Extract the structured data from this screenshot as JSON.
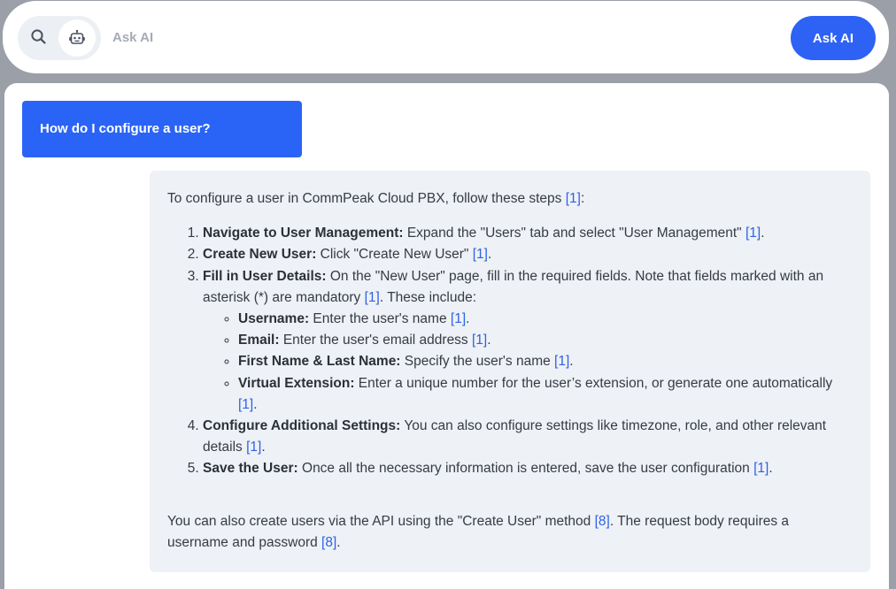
{
  "search": {
    "placeholder": "Ask AI",
    "value": "",
    "button_label": "Ask AI",
    "icons": [
      "search-icon",
      "robot-icon"
    ]
  },
  "chat": {
    "question": "How do I configure a user?",
    "answer": {
      "intro": "To configure a user in CommPeak Cloud PBX, follow these steps ",
      "intro_cite": "[1]",
      "intro_end": ":",
      "steps": [
        {
          "title": "Navigate to User Management:",
          "text": " Expand the \"Users\" tab and select \"User Management\" ",
          "cite": "[1]",
          "end": "."
        },
        {
          "title": "Create New User:",
          "text": " Click \"Create New User\" ",
          "cite": "[1]",
          "end": "."
        },
        {
          "title": "Fill in User Details:",
          "text": " On the \"New User\" page, fill in the required fields. Note that fields marked with an asterisk (*) are mandatory ",
          "cite": "[1]",
          "end": ". These include:",
          "subitems": [
            {
              "title": "Username:",
              "text": " Enter the user's name ",
              "cite": "[1]",
              "end": "."
            },
            {
              "title": "Email:",
              "text": " Enter the user's email address ",
              "cite": "[1]",
              "end": "."
            },
            {
              "title": "First Name & Last Name:",
              "text": " Specify the user's name ",
              "cite": "[1]",
              "end": "."
            },
            {
              "title": "Virtual Extension:",
              "text": " Enter a unique number for the user’s extension, or generate one automatically ",
              "cite": "[1]",
              "end": "."
            }
          ]
        },
        {
          "title": "Configure Additional Settings:",
          "text": " You can also configure settings like timezone, role, and other relevant details ",
          "cite": "[1]",
          "end": "."
        },
        {
          "title": "Save the User:",
          "text": " Once all the necessary information is entered, save the user configuration ",
          "cite": "[1]",
          "end": "."
        }
      ],
      "outro_1": "You can also create users via the API using the \"Create User\" method ",
      "outro_cite_1": "[8]",
      "outro_2": ". The request body requires a username and password ",
      "outro_cite_2": "[8]",
      "outro_end": "."
    }
  },
  "colors": {
    "accent": "#2e62f5",
    "citation": "#2d62e6",
    "answer_bg": "#eef1f5",
    "backdrop": "#9a9fa8"
  }
}
